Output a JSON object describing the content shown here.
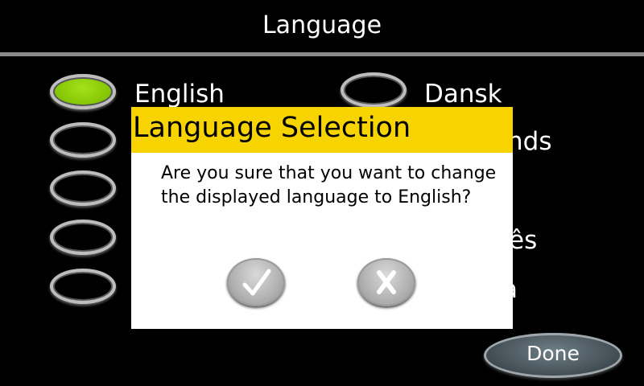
{
  "header": {
    "title": "Language"
  },
  "languages": [
    {
      "label": "English",
      "selected": true
    },
    {
      "label": "",
      "selected": false
    },
    {
      "label": "",
      "selected": false
    },
    {
      "label": "",
      "selected": false
    },
    {
      "label": "",
      "selected": false
    },
    {
      "label": "Dansk",
      "selected": false
    },
    {
      "label": "nds",
      "selected": false
    },
    {
      "label": "",
      "selected": false
    },
    {
      "label": "ês",
      "selected": false
    },
    {
      "label": "a",
      "selected": false
    }
  ],
  "dialog": {
    "title": "Language Selection",
    "message": "Are you sure that you want to change the displayed language to English?",
    "confirm_icon": "checkmark-icon",
    "cancel_icon": "x-icon"
  },
  "footer": {
    "done_label": "Done"
  },
  "colors": {
    "selected_radio": "#7cbf00",
    "dialog_header": "#f7d400"
  }
}
